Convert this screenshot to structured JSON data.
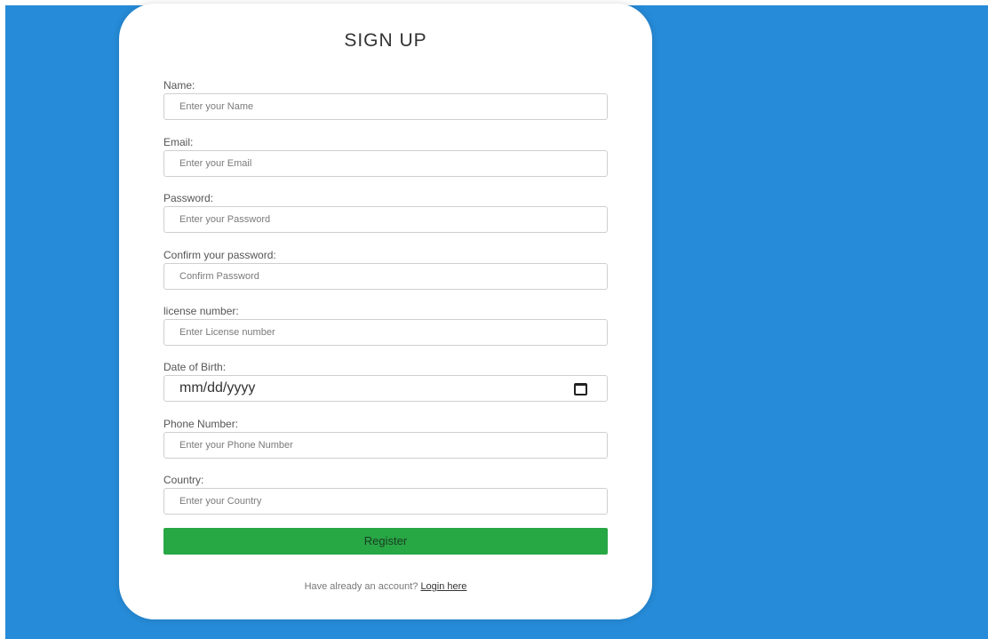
{
  "form": {
    "title": "SIGN UP",
    "fields": [
      {
        "label": "Name:",
        "placeholder": "Enter your Name"
      },
      {
        "label": "Email:",
        "placeholder": "Enter your Email"
      },
      {
        "label": "Password:",
        "placeholder": "Enter your Password"
      },
      {
        "label": "Confirm your password:",
        "placeholder": "Confirm Password"
      },
      {
        "label": "license number:",
        "placeholder": "Enter License number"
      },
      {
        "label": "Date of Birth:",
        "placeholder": "mm/dd/yyyy"
      },
      {
        "label": "Phone Number:",
        "placeholder": "Enter your Phone Number"
      },
      {
        "label": "Country:",
        "placeholder": "Enter your Country"
      }
    ],
    "register_label": "Register",
    "footer_text": "Have already an account?",
    "login_link": "Login here"
  },
  "colors": {
    "background": "#268bd8",
    "card": "#ffffff",
    "register_button": "#28a745"
  },
  "icons": {
    "date_picker": "calendar-icon"
  }
}
